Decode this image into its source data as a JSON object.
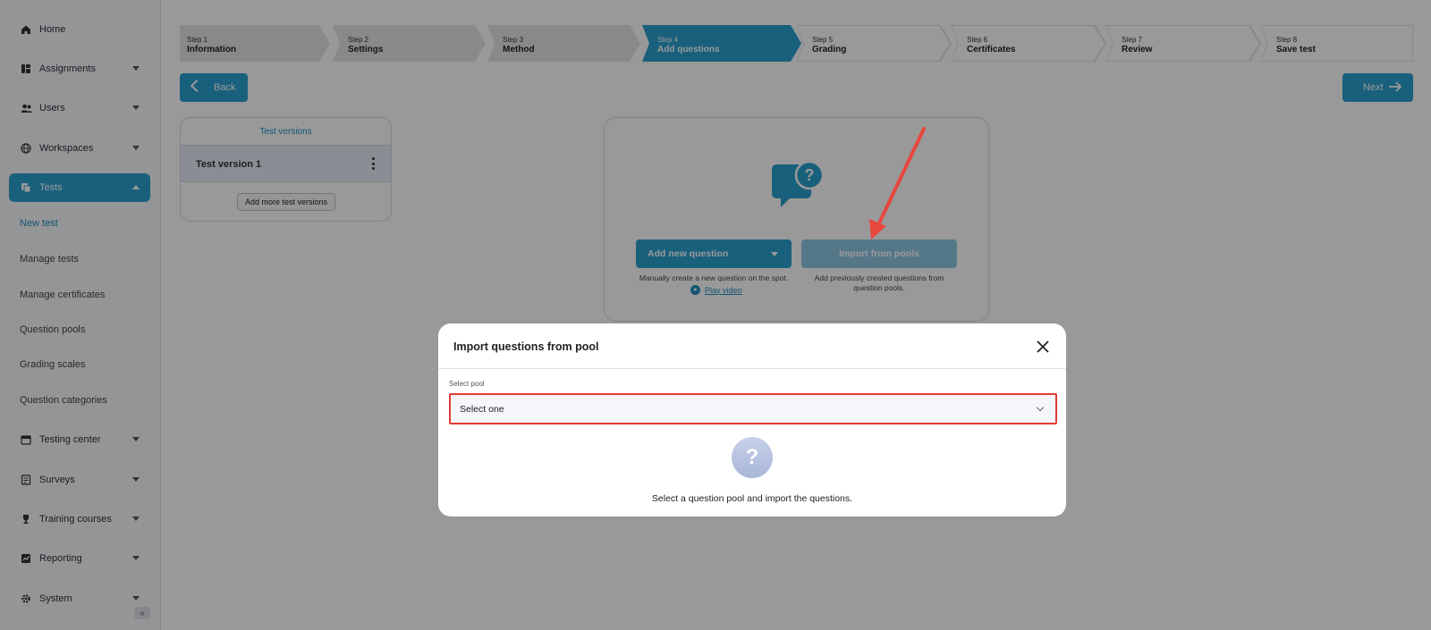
{
  "sidebar": {
    "items": [
      {
        "label": "Home",
        "icon": "home-icon"
      },
      {
        "label": "Assignments",
        "icon": "assignments-icon"
      },
      {
        "label": "Users",
        "icon": "users-icon"
      },
      {
        "label": "Workspaces",
        "icon": "globe-icon"
      },
      {
        "label": "Tests",
        "icon": "tests-icon",
        "active": true
      },
      {
        "label": "Testing center",
        "icon": "calendar-icon"
      },
      {
        "label": "Surveys",
        "icon": "survey-icon"
      },
      {
        "label": "Training courses",
        "icon": "trophy-icon"
      },
      {
        "label": "Reporting",
        "icon": "report-icon"
      },
      {
        "label": "System",
        "icon": "gear-icon"
      }
    ],
    "sub_items": [
      "New test",
      "Manage tests",
      "Manage certificates",
      "Question pools",
      "Grading scales",
      "Question categories"
    ],
    "collapse_glyph": "«"
  },
  "stepper": {
    "steps": [
      {
        "num": "Step 1",
        "label": "Information",
        "state": "done"
      },
      {
        "num": "Step 2",
        "label": "Settings",
        "state": "done"
      },
      {
        "num": "Step 3",
        "label": "Method",
        "state": "done"
      },
      {
        "num": "Step 4",
        "label": "Add questions",
        "state": "current"
      },
      {
        "num": "Step 5",
        "label": "Grading",
        "state": "todo"
      },
      {
        "num": "Step 6",
        "label": "Certificates",
        "state": "todo"
      },
      {
        "num": "Step 7",
        "label": "Review",
        "state": "todo"
      },
      {
        "num": "Step 8",
        "label": "Save test",
        "state": "todo"
      }
    ]
  },
  "nav_buttons": {
    "back": "Back",
    "next": "Next"
  },
  "versions": {
    "title": "Test versions",
    "items": [
      "Test version 1"
    ],
    "add_label": "Add more test versions"
  },
  "add_questions": {
    "add_new_label": "Add new question",
    "add_new_hint": "Manually create a new question on the spot.",
    "play_video": "Play video",
    "import_label": "Import from pools",
    "import_hint": "Add previously created questions from question pools."
  },
  "modal": {
    "title": "Import questions from pool",
    "field_label": "Select pool",
    "select_value": "Select one",
    "empty_icon_glyph": "?",
    "empty_text": "Select a question pool and import the questions."
  },
  "colors": {
    "accent": "#2aa0cf",
    "highlight": "#e23b35",
    "annotation_arrow": "#e8473d"
  }
}
